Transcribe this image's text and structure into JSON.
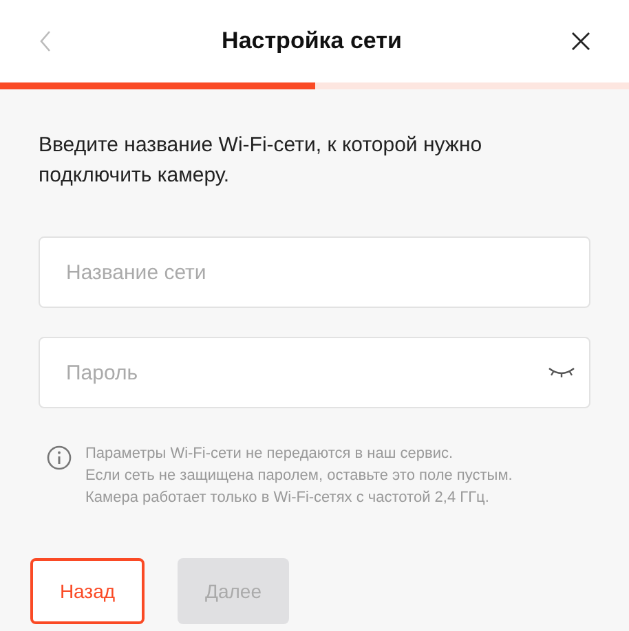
{
  "header": {
    "title": "Настройка сети"
  },
  "progress": {
    "level": 0.5
  },
  "instruction": "Введите название Wi-Fi-сети, к которой нужно подключить камеру.",
  "fields": [
    {
      "kind": "text",
      "placeholder": "Название сети"
    },
    {
      "kind": "password",
      "placeholder": "Пароль"
    }
  ],
  "note": [
    "Параметры Wi-Fi-сети не передаются в наш сервис.",
    "Если сеть не защищена паролем, оставьте это поле пустым.",
    "Камера работает только в Wi-Fi-сетях с частотой 2,4 ГГц."
  ],
  "buttons": [
    {
      "label": "Назад",
      "kind": "secondary",
      "disabled": false
    },
    {
      "label": "Далее",
      "kind": "primary",
      "disabled": true
    }
  ]
}
